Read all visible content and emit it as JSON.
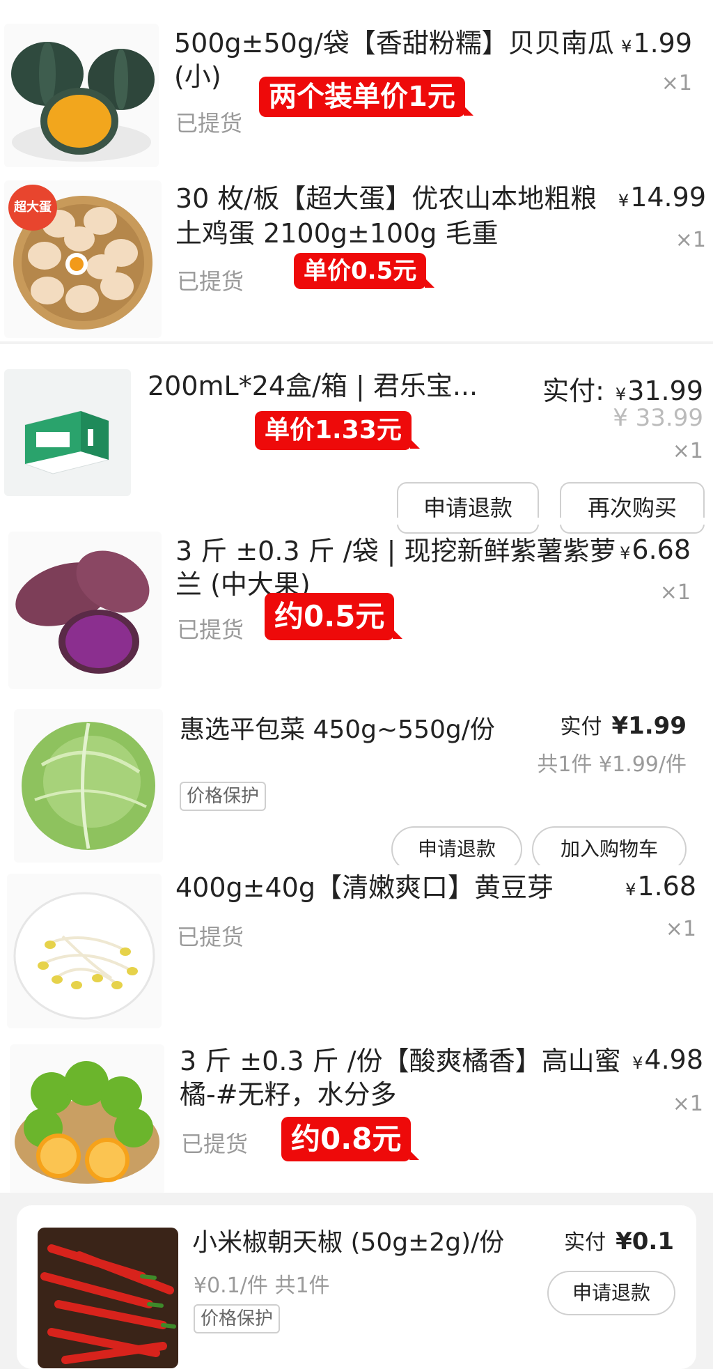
{
  "items": [
    {
      "title_l1": "500g±50g/袋【香甜粉糯】贝贝南瓜",
      "title_l2": "(小)",
      "status": "已提货",
      "currency": "¥",
      "price": "1.99",
      "qty": "×1",
      "tag": "两个装单价1元"
    },
    {
      "badge": "超大蛋",
      "title_l1": "30 枚/板【超大蛋】优农山本地粗粮",
      "title_l2": "土鸡蛋 2100g±100g 毛重",
      "status": "已提货",
      "currency": "¥",
      "price": "14.99",
      "qty": "×1",
      "tag": "单价0.5元"
    },
    {
      "title": "200mL*24盒/箱 | 君乐宝...",
      "paid_label": "实付:",
      "currency": "¥",
      "price": "31.99",
      "original_price": "¥ 33.99",
      "qty": "×1",
      "tag": "单价1.33元",
      "btn_refund": "申请退款",
      "btn_rebuy": "再次购买"
    },
    {
      "title_l1": "3 斤 ±0.3 斤 /袋 | 现挖新鲜紫薯紫萝",
      "title_l2": "兰 (中大果)",
      "status": "已提货",
      "currency": "¥",
      "price": "6.68",
      "qty": "×1",
      "tag": "约0.5元"
    },
    {
      "title": "惠选平包菜 450g~550g/份",
      "paid_label": "实付",
      "price": "¥1.99",
      "summary": "共1件 ¥1.99/件",
      "pill": "价格保护",
      "btn_refund": "申请退款",
      "btn_cart": "加入购物车"
    },
    {
      "title": "400g±40g【清嫩爽口】黄豆芽",
      "status": "已提货",
      "currency": "¥",
      "price": "1.68",
      "qty": "×1"
    },
    {
      "title_l1": "3 斤 ±0.3 斤 /份【酸爽橘香】高山蜜",
      "title_l2": "橘-#无籽，水分多",
      "status": "已提货",
      "currency": "¥",
      "price": "4.98",
      "qty": "×1",
      "tag": "约0.8元"
    },
    {
      "title": "小米椒朝天椒 (50g±2g)/份",
      "unit_info": "¥0.1/件  共1件",
      "pill": "价格保护",
      "paid_label": "实付",
      "price": "¥0.1",
      "btn_refund": "申请退款"
    }
  ],
  "colors": {
    "tag_red": "#ee0a0a",
    "text": "#222222",
    "muted": "#9a9a9a",
    "bg_gray": "#f2f2f2"
  }
}
